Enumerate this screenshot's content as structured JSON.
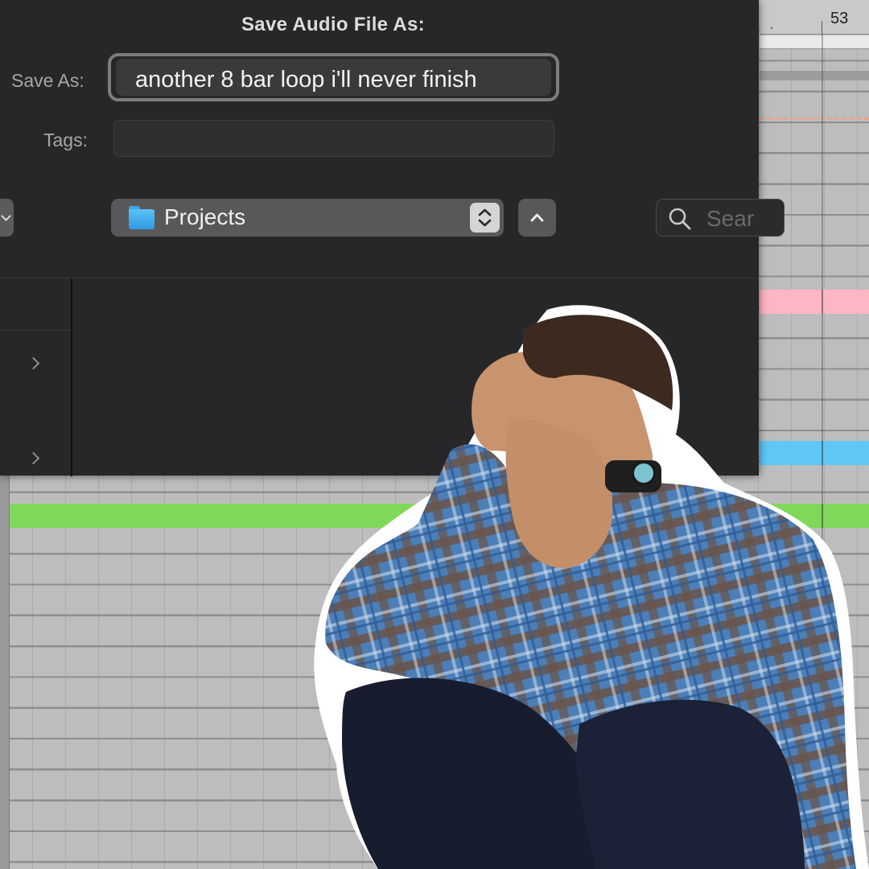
{
  "dialog": {
    "title": "Save Audio File As:",
    "save_as_label": "Save As:",
    "save_as_value": "another 8 bar loop i'll never finish",
    "tags_label": "Tags:",
    "tags_value": "",
    "location": "Projects",
    "search_placeholder": "Sear"
  },
  "daw": {
    "bar_number": "53",
    "clip_colors": {
      "pink": "#ffb6c4",
      "blue": "#5ec7f6",
      "green": "#7fd85a"
    }
  },
  "icons": [
    "folder-icon",
    "stepper-icon",
    "chevron-up-icon",
    "search-icon",
    "chevron-right-icon",
    "chevron-left-icon"
  ]
}
